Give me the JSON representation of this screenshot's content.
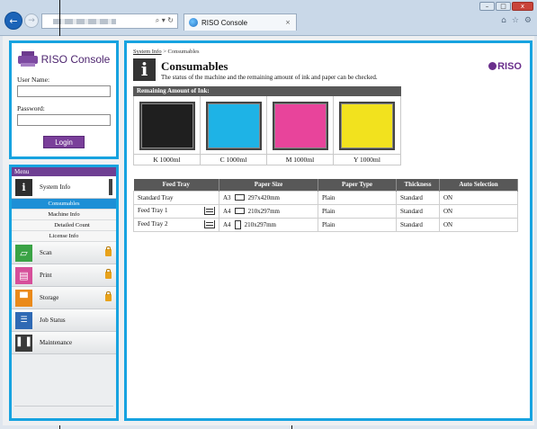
{
  "browser": {
    "tab_title": "RISO Console",
    "tab_close": "×",
    "addr_icons": "⌕ ▾ ↻",
    "back_icon": "←",
    "forward_icon": "→",
    "window_buttons": [
      "–",
      "□",
      "x"
    ],
    "toolbar_icons": [
      "⌂",
      "☆",
      "⚙"
    ]
  },
  "login": {
    "logo_text": "RISO Console",
    "username_label": "User Name:",
    "password_label": "Password:",
    "login_button": "Login"
  },
  "menu": {
    "header": "Menu",
    "items": [
      {
        "label": "System Info",
        "icon": "info-icon",
        "active": true
      },
      {
        "label": "Scan",
        "icon": "scan-icon",
        "locked": true
      },
      {
        "label": "Print",
        "icon": "print-icon",
        "locked": true
      },
      {
        "label": "Storage",
        "icon": "storage-icon",
        "locked": true
      },
      {
        "label": "Job Status",
        "icon": "job-status-icon"
      },
      {
        "label": "Maintenance",
        "icon": "maintenance-icon"
      }
    ],
    "subitems": [
      "Consumables",
      "Machine Info",
      "Detailed Count",
      "License Info"
    ]
  },
  "main": {
    "breadcrumb_link": "System Info",
    "breadcrumb_sep": " > ",
    "breadcrumb_current": "Consumables",
    "title": "Consumables",
    "description": "The status of the machine and the remaining amount of ink and paper can be checked.",
    "brand": "RISO",
    "ink_header": "Remaining Amount of Ink:",
    "inks": [
      {
        "label": "K 1000ml",
        "color": "#1f1f1f"
      },
      {
        "label": "C 1000ml",
        "color": "#1eb3e6"
      },
      {
        "label": "M 1000ml",
        "color": "#e8449b"
      },
      {
        "label": "Y 1000ml",
        "color": "#f2e21e"
      }
    ],
    "tray_headers": [
      "Feed Tray",
      "Paper Size",
      "Paper Type",
      "Thickness",
      "Auto Selection"
    ],
    "trays": [
      {
        "name": "Standard Tray",
        "size": "A3",
        "dims": "297x420mm",
        "type": "Plain",
        "thickness": "Standard",
        "auto": "ON"
      },
      {
        "name": "Feed Tray 1",
        "size": "A4",
        "dims": "210x297mm",
        "type": "Plain",
        "thickness": "Standard",
        "auto": "ON"
      },
      {
        "name": "Feed Tray 2",
        "size": "A4",
        "dims": "210x297mm",
        "type": "Plain",
        "thickness": "Standard",
        "auto": "ON"
      }
    ]
  }
}
